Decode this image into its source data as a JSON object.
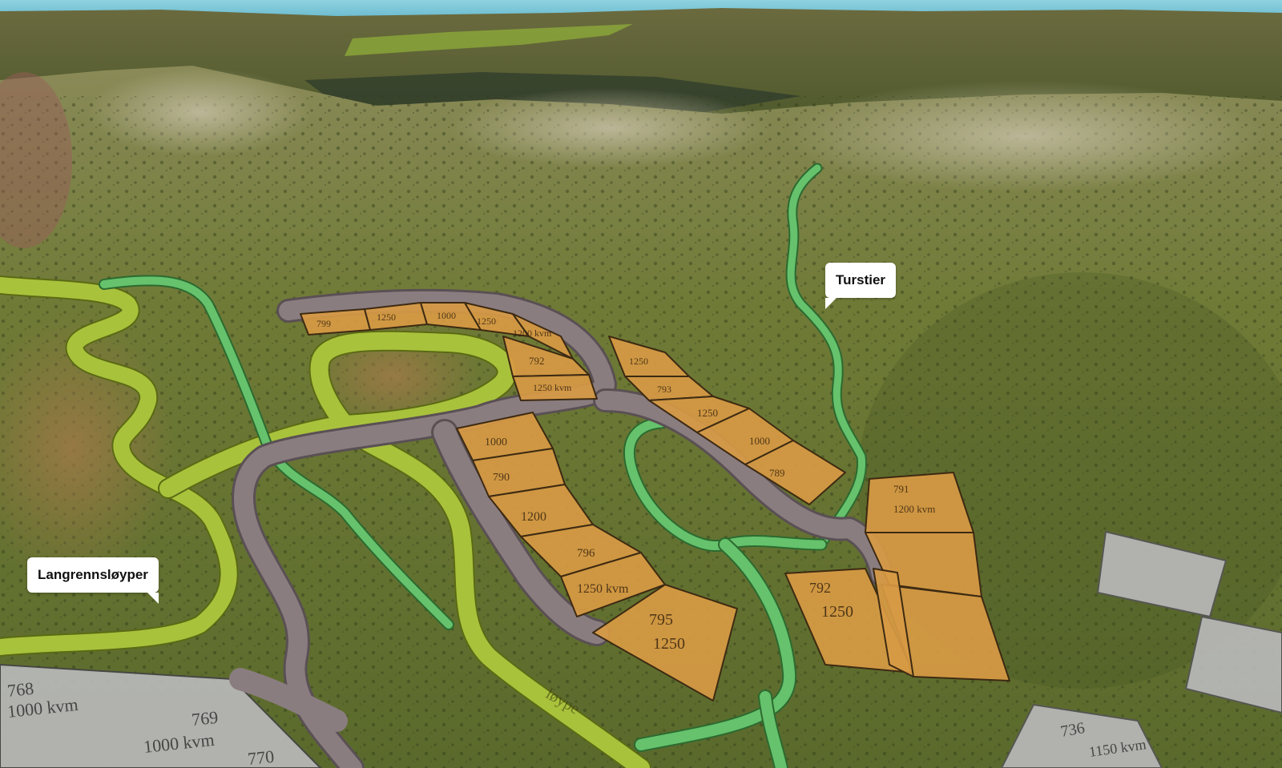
{
  "callouts": {
    "turstier": "Turstier",
    "langrennsloyper": "Langrennsløyper"
  },
  "trail_text": "løype",
  "plots": {
    "orange": [
      {
        "id": "plot-a1",
        "label": "799"
      },
      {
        "id": "plot-a2",
        "label": "1250"
      },
      {
        "id": "plot-b1",
        "label": "1000"
      },
      {
        "id": "plot-b2",
        "label": "1250"
      },
      {
        "id": "plot-b3",
        "label": "1200 kvm"
      },
      {
        "id": "plot-c1",
        "label": "792"
      },
      {
        "id": "plot-c2",
        "label": "1250 kvm"
      },
      {
        "id": "plot-c3",
        "label": "1250"
      },
      {
        "id": "plot-d1",
        "label": "793"
      },
      {
        "id": "plot-d2",
        "label": "1250"
      },
      {
        "id": "plot-d3",
        "label": "1000"
      },
      {
        "id": "plot-d4",
        "label": "789"
      },
      {
        "id": "plot-d5",
        "label": "1000"
      },
      {
        "id": "plot-d6",
        "label": "790"
      },
      {
        "id": "plot-d7",
        "label": "1200"
      },
      {
        "id": "plot-e1",
        "label": "796"
      },
      {
        "id": "plot-e2",
        "label": "1250 kvm"
      },
      {
        "id": "plot-e3",
        "label": "795"
      },
      {
        "id": "plot-e4",
        "label": "1250"
      },
      {
        "id": "plot-e5",
        "label": "791"
      },
      {
        "id": "plot-e6",
        "label": "1200 kvm"
      },
      {
        "id": "plot-e7",
        "label": "792"
      },
      {
        "id": "plot-e8",
        "label": "1250"
      }
    ],
    "grey": [
      {
        "id": "grey-1",
        "label": "768"
      },
      {
        "id": "grey-2",
        "label": "1000 kvm"
      },
      {
        "id": "grey-3",
        "label": "769"
      },
      {
        "id": "grey-4",
        "label": "1000 kvm"
      },
      {
        "id": "grey-5",
        "label": "770"
      },
      {
        "id": "grey-6",
        "label": "736"
      },
      {
        "id": "grey-7",
        "label": "1150 kvm"
      }
    ]
  },
  "colors": {
    "sky": "#7fc8d8",
    "terrain": "#6d7a3a",
    "plot_orange": "#d89a44",
    "road_grey": "#8a7d80",
    "ski_trail": "#a9c23c",
    "hiking_trail": "#5fbf6a",
    "existing_plot": "#b9b9b9"
  }
}
